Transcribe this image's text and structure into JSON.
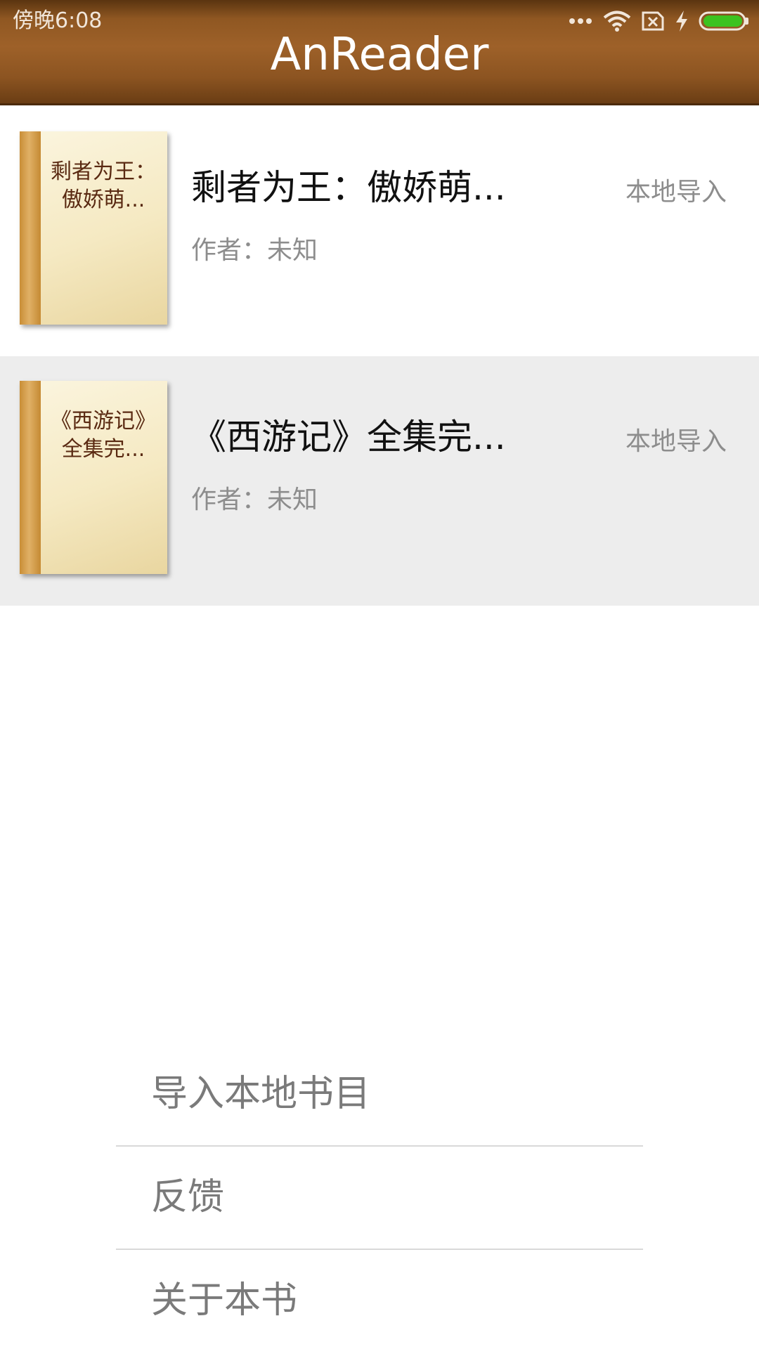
{
  "status_bar": {
    "time": "傍晚6:08",
    "icons": [
      "more-dots-icon",
      "wifi-icon",
      "no-sim-icon",
      "charging-bolt-icon",
      "battery-icon"
    ],
    "battery_color": "#3cc21f"
  },
  "app_bar": {
    "title": "AnReader",
    "color": "#9e6129"
  },
  "books": [
    {
      "cover_text": "剩者为王：傲娇萌...",
      "title": "剩者为王：傲娇萌...",
      "author": "作者：未知",
      "source": "本地导入",
      "selected": false
    },
    {
      "cover_text": "《西游记》全集完...",
      "title": "《西游记》全集完...",
      "author": "作者：未知",
      "source": "本地导入",
      "selected": true
    }
  ],
  "menu": {
    "items": [
      {
        "label": "导入本地书目"
      },
      {
        "label": "反馈"
      },
      {
        "label": "关于本书"
      }
    ]
  }
}
